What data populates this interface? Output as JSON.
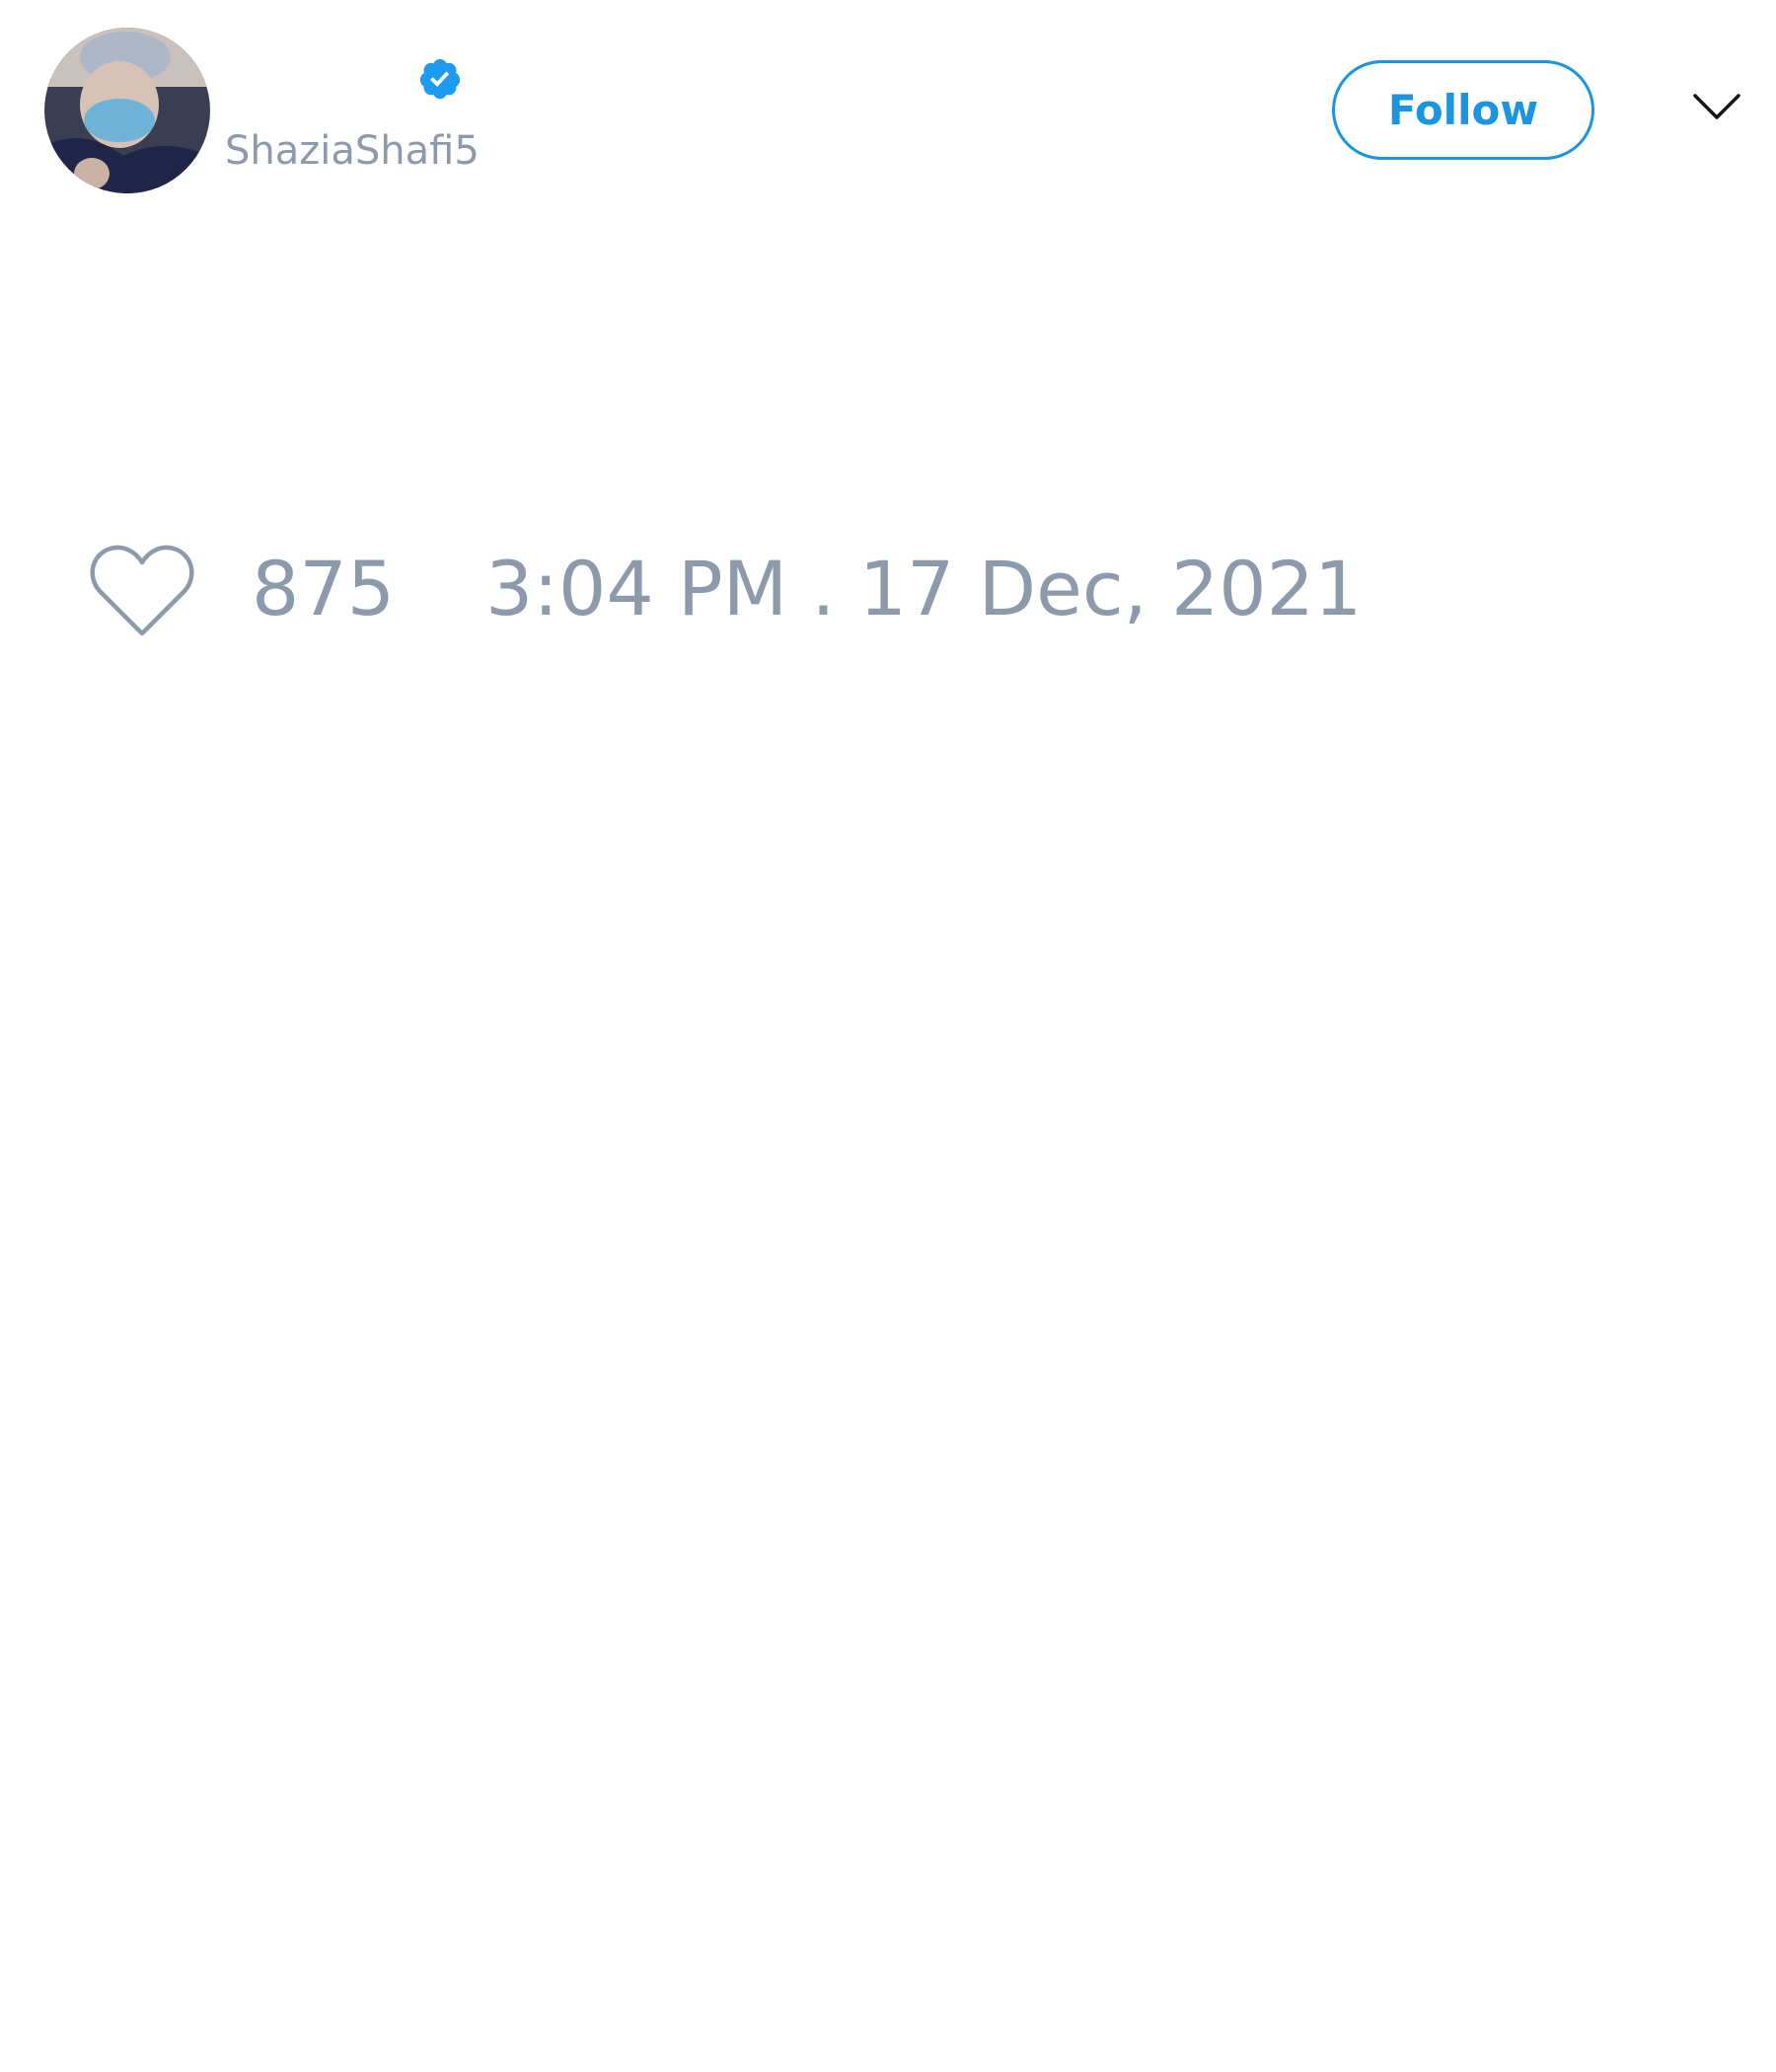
{
  "author": {
    "display_name": "",
    "handle": "ShaziaShafi5",
    "verified": true,
    "avatar_icon": "user-avatar-photo"
  },
  "actions": {
    "follow_label": "Follow",
    "menu_icon": "chevron-down-icon"
  },
  "stats": {
    "like_icon": "heart-outline-icon",
    "likes": "875",
    "timestamp": "3:04 PM . 17 Dec, 2021"
  },
  "colors": {
    "accent": "#1b95e0",
    "muted_text": "#8d9aab",
    "verified_badge": "#1d9bf0",
    "background": "#ffffff"
  }
}
